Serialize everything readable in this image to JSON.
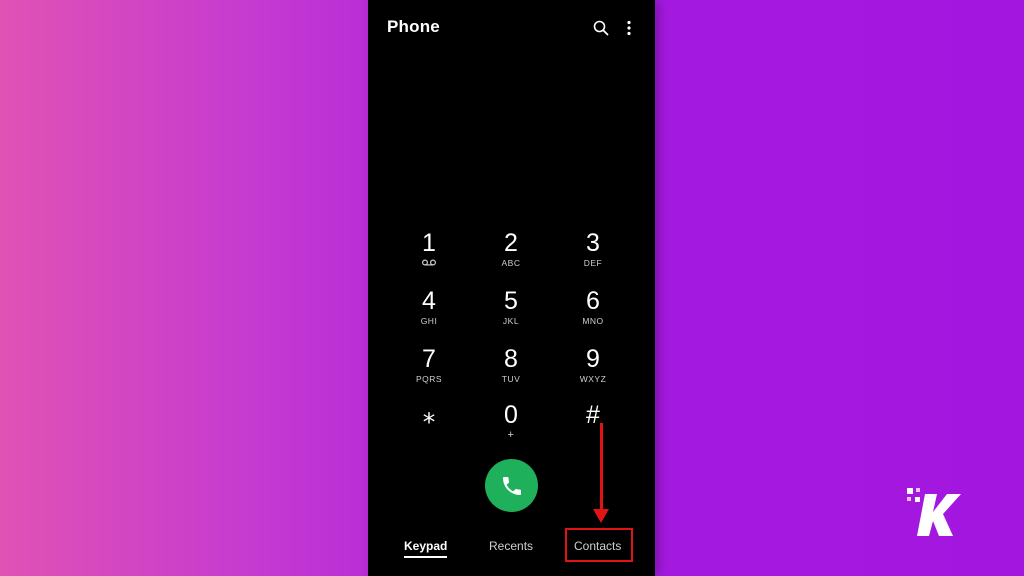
{
  "app": {
    "title": "Phone"
  },
  "toolbar": {
    "search_icon": "search-icon",
    "menu_icon": "more-vert-icon"
  },
  "keypad": {
    "keys": [
      {
        "digit": "1",
        "letters": ""
      },
      {
        "digit": "2",
        "letters": "ABC"
      },
      {
        "digit": "3",
        "letters": "DEF"
      },
      {
        "digit": "4",
        "letters": "GHI"
      },
      {
        "digit": "5",
        "letters": "JKL"
      },
      {
        "digit": "6",
        "letters": "MNO"
      },
      {
        "digit": "7",
        "letters": "PQRS"
      },
      {
        "digit": "8",
        "letters": "TUV"
      },
      {
        "digit": "9",
        "letters": "WXYZ"
      },
      {
        "digit": "⁎",
        "letters": ""
      },
      {
        "digit": "0",
        "letters": "+"
      },
      {
        "digit": "#",
        "letters": ""
      }
    ],
    "voicemail_icon": "voicemail-icon"
  },
  "call_button": {
    "icon": "phone-icon",
    "color": "#1fb05c"
  },
  "tabs": [
    {
      "label": "Keypad",
      "active": true
    },
    {
      "label": "Recents",
      "active": false
    },
    {
      "label": "Contacts",
      "active": false
    }
  ],
  "annotation": {
    "color": "#e01414",
    "target": "Contacts"
  },
  "brand": {
    "logo": "knowtechie-k-logo",
    "color": "#ffffff"
  }
}
